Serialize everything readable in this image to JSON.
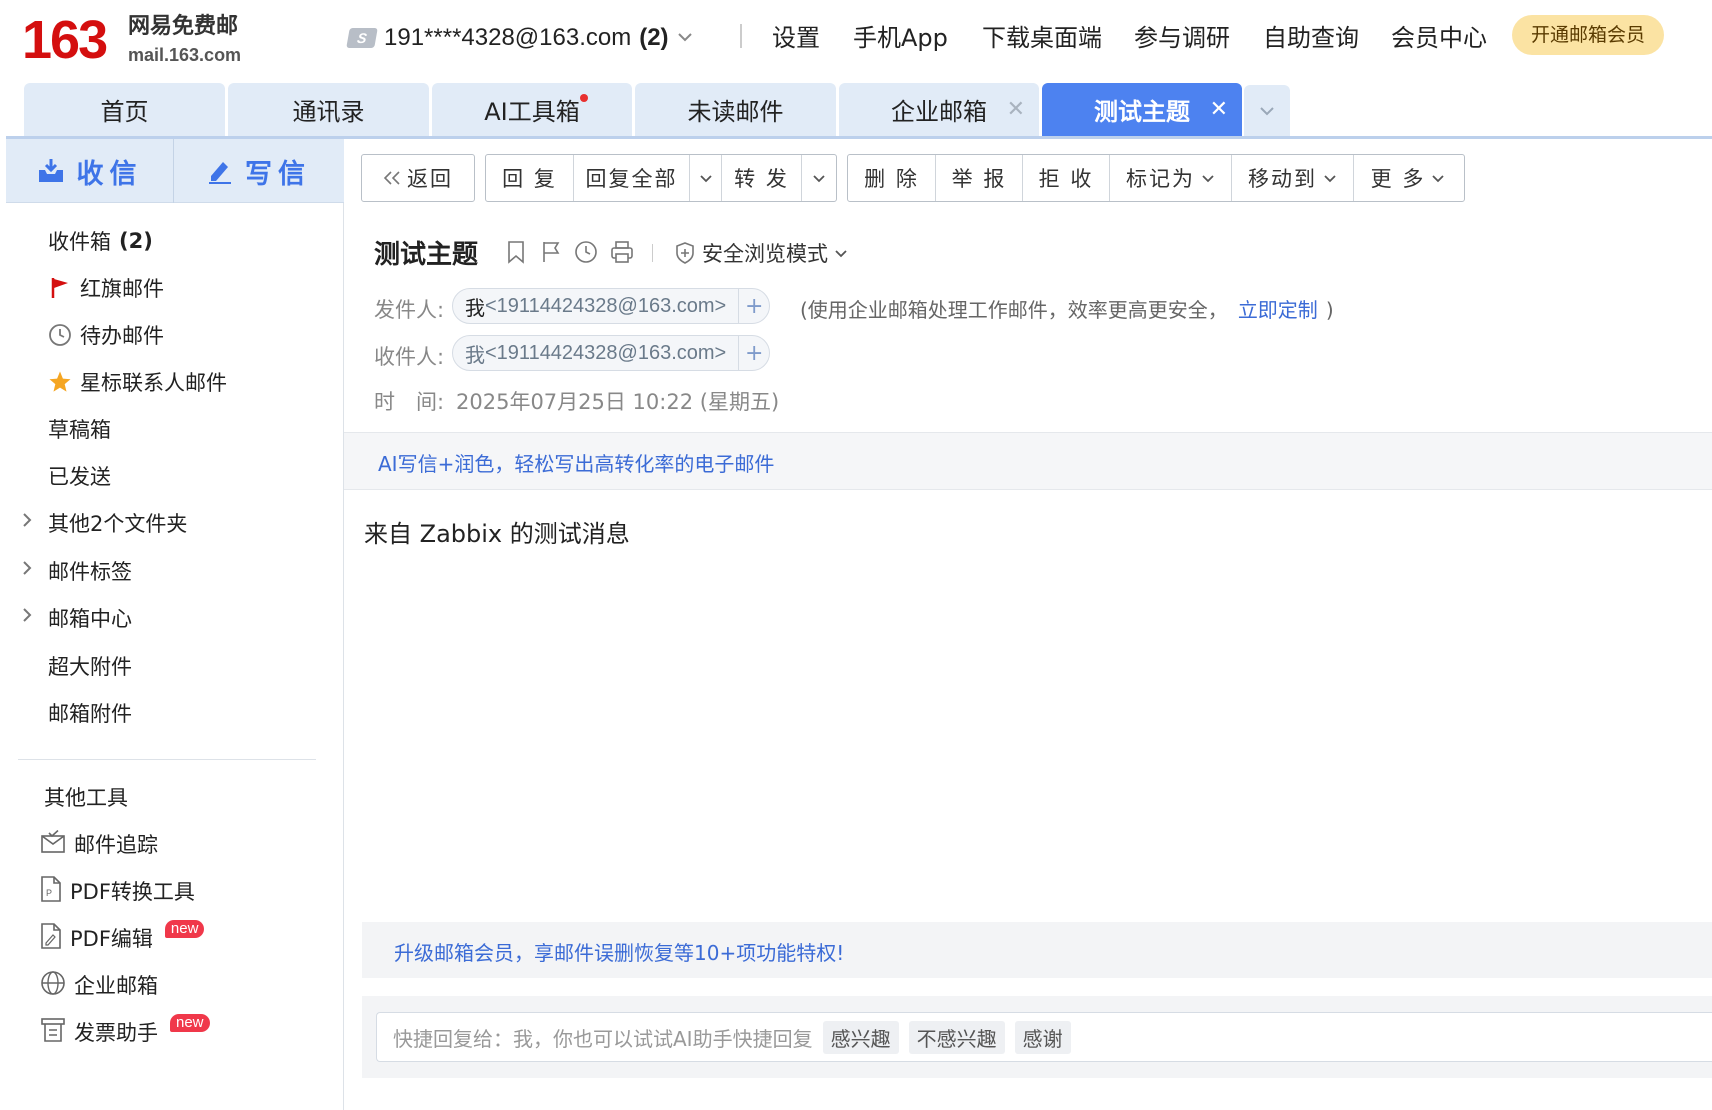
{
  "header": {
    "logo_number": "163",
    "logo_cn": "网易免费邮",
    "logo_en": "mail.163.com",
    "account_icon": "S",
    "account": "191****4328@163.com",
    "account_count": "(2)",
    "links": [
      "设置",
      "手机App",
      "下载桌面端",
      "参与调研",
      "自助查询",
      "会员中心"
    ],
    "vip_button": "开通邮箱会员"
  },
  "tabs": [
    {
      "label": "首页"
    },
    {
      "label": "通讯录"
    },
    {
      "label": "AI工具箱"
    },
    {
      "label": "未读邮件"
    },
    {
      "label": "企业邮箱"
    },
    {
      "label": "测试主题"
    }
  ],
  "sidebar": {
    "receive": "收信",
    "compose": "写信",
    "inbox_label": "收件箱",
    "inbox_count": "(2)",
    "items": [
      "红旗邮件",
      "待办邮件",
      "星标联系人邮件",
      "草稿箱",
      "已发送",
      "其他2个文件夹",
      "邮件标签",
      "邮箱中心",
      "超大附件",
      "邮箱附件"
    ],
    "tools_title": "其他工具",
    "tools": [
      "邮件追踪",
      "PDF转换工具",
      "PDF编辑",
      "企业邮箱",
      "发票助手"
    ],
    "new_badge": "new"
  },
  "toolbar": {
    "back": "返回",
    "reply": "回 复",
    "reply_all": "回复全部",
    "forward": "转 发",
    "delete": "删 除",
    "report": "举 报",
    "reject": "拒 收",
    "mark_as": "标记为",
    "move_to": "移动到",
    "more": "更 多"
  },
  "message": {
    "subject": "测试主题",
    "safe_mode": "安全浏览模式",
    "from_label": "发件人:",
    "from_me": "我",
    "from_addr": "<19114424328@163.com>",
    "from_note": "(使用企业邮箱处理工作邮件，效率更高更安全，",
    "from_link": "立即定制",
    "from_note_end": ")",
    "to_label": "收件人:",
    "to_me": "我",
    "to_addr": "<19114424328@163.com>",
    "time_label": "时　间:",
    "time_value": "2025年07月25日 10:22 (星期五)",
    "ai_banner": "AI写信+润色，轻松写出高转化率的电子邮件",
    "body": "来自 Zabbix 的测试消息",
    "vip_banner": "升级邮箱会员，享邮件误删恢复等10+项功能特权!",
    "quick_reply_hint": "快捷回复给：我，你也可以试试AI助手快捷回复",
    "quick_chips": [
      "感兴趣",
      "不感兴趣",
      "感谢"
    ]
  },
  "colors": {
    "brand_red": "#d40f0f",
    "accent_blue": "#4d82f0",
    "link_blue": "#3b6bd6"
  }
}
